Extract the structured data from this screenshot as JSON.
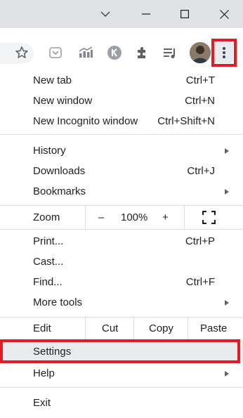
{
  "window": {
    "controls": [
      "tab-search-dropdown",
      "minimize",
      "maximize",
      "close"
    ]
  },
  "toolbar": {
    "icons": [
      "star-icon",
      "extension-pocket-icon",
      "extension-chart-icon",
      "extension-k-icon",
      "puzzle-icon",
      "media-control-icon",
      "avatar"
    ],
    "highlight_color": "#e41b23"
  },
  "menu": {
    "group1": [
      {
        "label": "New tab",
        "shortcut": "Ctrl+T"
      },
      {
        "label": "New window",
        "shortcut": "Ctrl+N"
      },
      {
        "label": "New Incognito window",
        "shortcut": "Ctrl+Shift+N"
      }
    ],
    "group2": [
      {
        "label": "History",
        "shortcut": ""
      },
      {
        "label": "Downloads",
        "shortcut": "Ctrl+J"
      },
      {
        "label": "Bookmarks",
        "shortcut": ""
      }
    ],
    "zoom": {
      "label": "Zoom",
      "minus": "–",
      "value": "100%",
      "plus": "+"
    },
    "group3": [
      {
        "label": "Print...",
        "shortcut": "Ctrl+P"
      },
      {
        "label": "Cast...",
        "shortcut": ""
      },
      {
        "label": "Find...",
        "shortcut": "Ctrl+F"
      },
      {
        "label": "More tools",
        "shortcut": ""
      }
    ],
    "edit": {
      "label": "Edit",
      "cut": "Cut",
      "copy": "Copy",
      "paste": "Paste"
    },
    "settings": {
      "label": "Settings"
    },
    "help": {
      "label": "Help"
    },
    "exit": {
      "label": "Exit"
    }
  }
}
